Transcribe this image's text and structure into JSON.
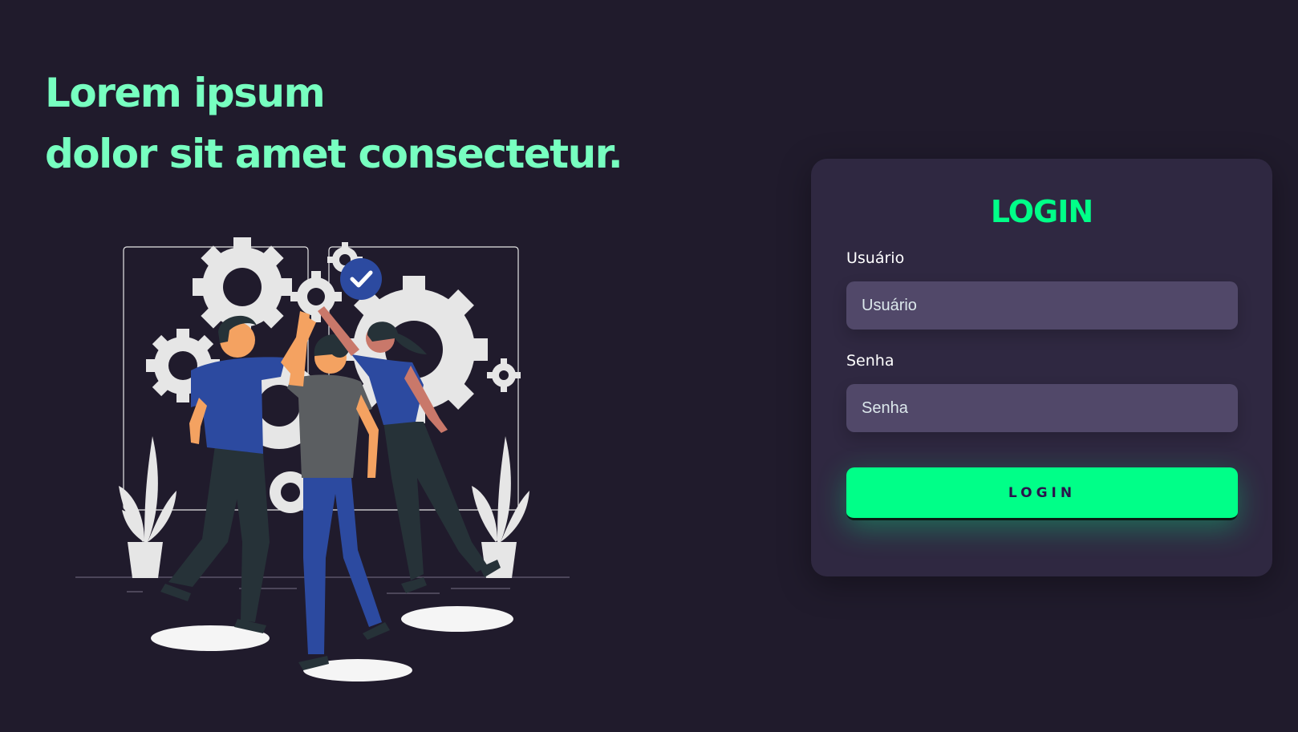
{
  "hero": {
    "line1": "Lorem ipsum",
    "line2": "dolor sit amet consectetur."
  },
  "login_card": {
    "title": "LOGIN",
    "username_label": "Usuário",
    "username_placeholder": "Usuário",
    "password_label": "Senha",
    "password_placeholder": "Senha",
    "button_label": "LOGIN"
  },
  "colors": {
    "background": "#201b2c",
    "card": "#2f2841",
    "input": "#514869",
    "accent": "#00ff88",
    "headline": "#77ffc0"
  },
  "illustration": {
    "icon": "team-high-five-gears-illustration"
  }
}
